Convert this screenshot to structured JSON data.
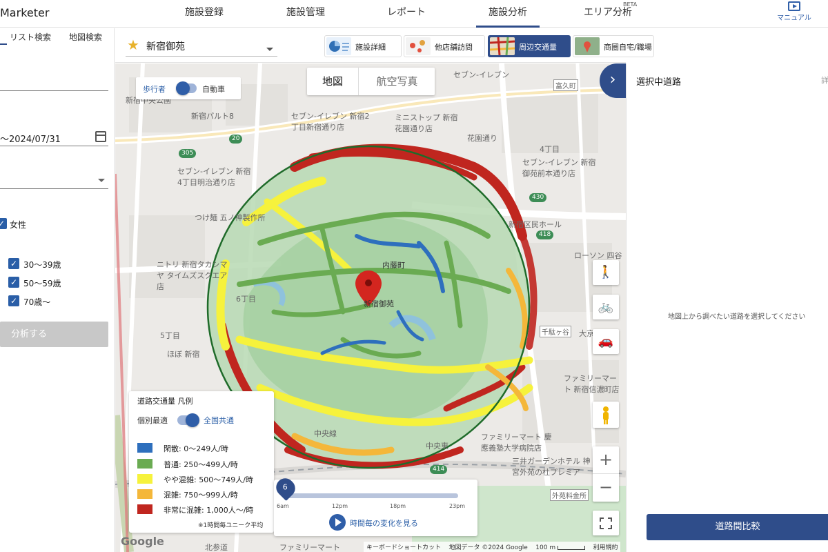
{
  "app": {
    "brand": "Marketer"
  },
  "nav": {
    "items": [
      "施設登録",
      "施設管理",
      "レポート",
      "施設分析",
      "エリア分析"
    ],
    "beta": "BETA",
    "manual": "マニュアル"
  },
  "left": {
    "tabs": [
      "リスト検索",
      "地図検索"
    ],
    "date_range": "〜2024/07/31",
    "gender_option": "女性",
    "age_options": [
      "30〜39歳",
      "50〜59歳",
      "70歳〜"
    ],
    "analyze_button": "分析する"
  },
  "facility": {
    "name": "新宿御苑",
    "tabs": [
      "施設詳細",
      "他店舗訪問",
      "周辺交通量",
      "商圏自宅/職場"
    ],
    "active_tab": "周辺交通量"
  },
  "map": {
    "mode_left": "歩行者",
    "mode_right": "自動車",
    "map_type": [
      "地図",
      "航空写真"
    ],
    "labels": [
      "セブン-イレブン",
      "新宿中央公園",
      "新宿パルト8",
      "セブン-イレブン 新宿2丁目新宿通り店",
      "ミニストップ 新宿 花園通り店",
      "花園通り",
      "4丁目",
      "セブン-イレブン 新宿御苑前本通り店",
      "セブン-イレブン 新宿4丁目明治通り店",
      "つけ麺 五ノ神製作所",
      "新宿区民ホール",
      "ニトリ 新宿タカシマヤ タイムズスクエア店",
      "内藤町",
      "6丁目",
      "新宿御苑",
      "大京町",
      "5丁目",
      "ほぼ 新宿",
      "中央線",
      "ファミリーマート 慶應義塾大学病院店",
      "三井ガーデンホテル 神宮外苑の杜プレミア",
      "外苑料金所",
      "ファミリーマート 新宿信濃町店",
      "ローソン 四谷",
      "北参道",
      "ファミリーマート",
      "富久町",
      "千駄ヶ谷",
      "中央東"
    ],
    "shields": [
      "20",
      "305",
      "430",
      "418",
      "414"
    ],
    "legend": {
      "title": "道路交通量 凡例",
      "toggle_left": "個別最適",
      "toggle_right": "全国共通",
      "rows": [
        {
          "color": "#2e6fbd",
          "label": "閑散: 0〜249人/時"
        },
        {
          "color": "#6aab52",
          "label": "普通: 250〜499人/時"
        },
        {
          "color": "#f6f23c",
          "label": "やや混雑: 500〜749人/時"
        },
        {
          "color": "#f4b73a",
          "label": "混雑: 750〜999人/時"
        },
        {
          "color": "#c0261f",
          "label": "非常に混雑: 1,000人〜/時"
        }
      ],
      "note": "※1時間毎ユニーク平均"
    },
    "timeline": {
      "current_hour_label": "6",
      "progress": 0.03,
      "ticks": [
        "6am",
        "12pm",
        "18pm",
        "23pm"
      ],
      "play_label": "時間毎の変化を見る"
    },
    "footer": {
      "shortcut": "キーボードショートカット",
      "data": "地図データ ©2024 Google",
      "scale": "100 m",
      "terms": "利用規約"
    },
    "google": "Google"
  },
  "right": {
    "title": "選択中道路",
    "corner": "詳",
    "empty": "地図上から調べたい道路を選択してください",
    "compare_button": "道路間比較"
  }
}
